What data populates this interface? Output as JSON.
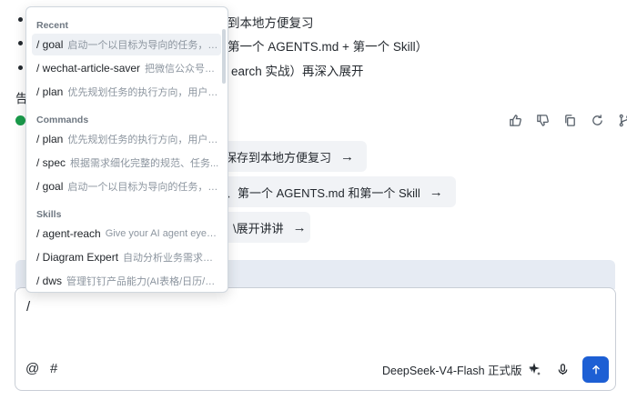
{
  "background": {
    "lines": [
      "到本地方便复习",
      "第一个 AGENTS.md + 第一个 Skill）",
      "earch 实战）再深入展开"
    ],
    "partial_text": "告"
  },
  "suggestions": [
    {
      "label": "件保存到本地方便复习"
    },
    {
      "label": "、第一个 AGENTS.md 和第一个 Skill"
    },
    {
      "label": "\\展开讲讲"
    }
  ],
  "composer": {
    "value": "/",
    "mention_symbol": "@",
    "hash_symbol": "#",
    "model": "DeepSeek-V4-Flash 正式版"
  },
  "menu": {
    "sections": [
      {
        "title": "Recent",
        "items": [
          {
            "name": "goal",
            "desc": "启动一个以目标为导向的任务，并..."
          },
          {
            "name": "wechat-article-saver",
            "desc": "把微信公众号文..."
          },
          {
            "name": "plan",
            "desc": "优先规划任务的执行方向，用户确..."
          }
        ]
      },
      {
        "title": "Commands",
        "items": [
          {
            "name": "plan",
            "desc": "优先规划任务的执行方向，用户确..."
          },
          {
            "name": "spec",
            "desc": "根据需求细化完整的规范、任务..."
          },
          {
            "name": "goal",
            "desc": "启动一个以目标为导向的任务，并..."
          }
        ]
      },
      {
        "title": "Skills",
        "items": [
          {
            "name": "agent-reach",
            "desc": "Give your AI agent eyes t..."
          },
          {
            "name": "Diagram Expert",
            "desc": "自动分析业务需求，..."
          },
          {
            "name": "dws",
            "desc": "管理钉钉产品能力(AI表格/日历/通..."
          }
        ]
      }
    ]
  },
  "colors": {
    "accent": "#1d5fd4",
    "success": "#1a9b4b"
  },
  "icons": [
    "thumbs-up-icon",
    "thumbs-down-icon",
    "copy-icon",
    "refresh-icon",
    "branch-icon",
    "sparkle-icon",
    "microphone-icon",
    "arrow-up-icon",
    "chevron-down-icon"
  ]
}
